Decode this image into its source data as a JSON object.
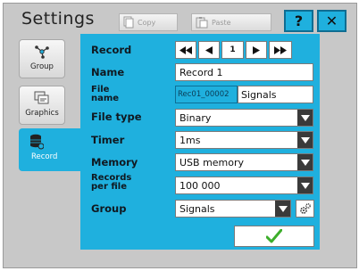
{
  "window": {
    "title": "Settings"
  },
  "toolbar": {
    "copy_label": "Copy",
    "paste_label": "Paste",
    "help_label": "?",
    "close_label": "✕"
  },
  "sidebar": {
    "items": [
      {
        "label": "Group",
        "icon": "group-network-icon"
      },
      {
        "label": "Graphics",
        "icon": "graphics-windows-icon"
      },
      {
        "label": "Record",
        "icon": "database-icon",
        "active": true
      }
    ]
  },
  "record_panel": {
    "record": {
      "label": "Record",
      "index": "1"
    },
    "name": {
      "label": "Name",
      "value": "Record 1"
    },
    "file_name": {
      "label_line1": "File",
      "label_line2": "name",
      "prefix": "Rec01_00002",
      "value": "Signals"
    },
    "file_type": {
      "label": "File type",
      "value": "Binary"
    },
    "timer": {
      "label": "Timer",
      "value": "1ms"
    },
    "memory": {
      "label": "Memory",
      "value": "USB memory"
    },
    "records_per_file": {
      "label_line1": "Records",
      "label_line2": "per file",
      "value": "100 000"
    },
    "group": {
      "label": "Group",
      "value": "Signals"
    }
  },
  "colors": {
    "accent": "#1fb0de",
    "background": "#c8c8c8",
    "confirm": "#3dae2b"
  }
}
